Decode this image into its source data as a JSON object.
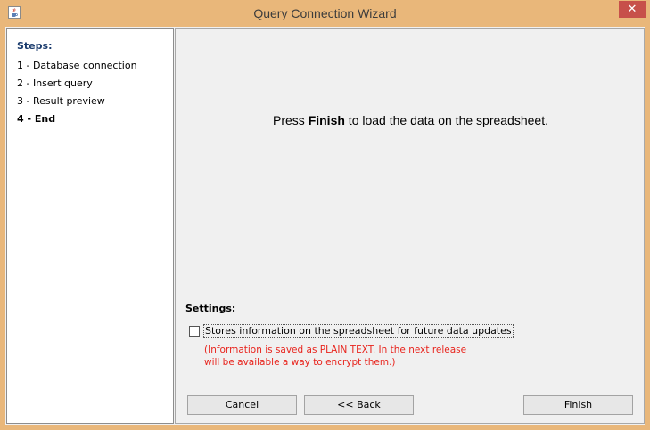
{
  "window": {
    "title": "Query Connection Wizard",
    "close_label": "✕"
  },
  "steps": {
    "title": "Steps:",
    "items": [
      {
        "label": "1 - Database connection",
        "active": false
      },
      {
        "label": "2 - Insert query",
        "active": false
      },
      {
        "label": "3 - Result preview",
        "active": false
      },
      {
        "label": "4 - End",
        "active": true
      }
    ]
  },
  "main": {
    "message_prefix": "Press ",
    "message_bold": "Finish",
    "message_suffix": " to load the data on the spreadsheet."
  },
  "settings": {
    "title": "Settings:",
    "store_checkbox_label": "Stores information on the spreadsheet for future data updates",
    "store_checkbox_checked": false,
    "warning_line1": "(Information is saved as PLAIN TEXT. In the next release",
    "warning_line2": "will be available a way to encrypt them.)"
  },
  "buttons": {
    "cancel": "Cancel",
    "back": "<< Back",
    "finish": "Finish"
  },
  "colors": {
    "window_frame": "#e9b77a",
    "close_button": "#c7504a",
    "steps_title": "#1b3c6e",
    "warning_text": "#e8231c"
  }
}
